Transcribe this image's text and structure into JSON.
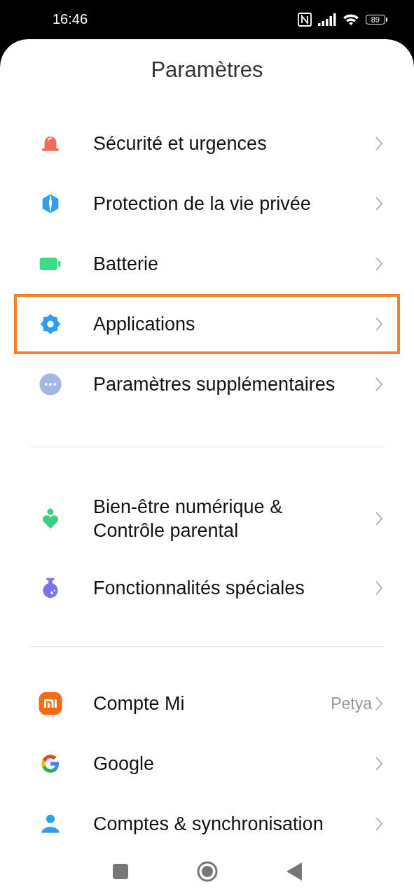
{
  "status_bar": {
    "time": "16:46",
    "battery": "89"
  },
  "title": "Paramètres",
  "groups": [
    {
      "items": [
        {
          "label": "Sécurité et urgences",
          "highlighted": false
        },
        {
          "label": "Protection de la vie privée",
          "highlighted": false
        },
        {
          "label": "Batterie",
          "highlighted": false
        },
        {
          "label": "Applications",
          "highlighted": true
        },
        {
          "label": "Paramètres supplémentaires",
          "highlighted": false
        }
      ]
    },
    {
      "items": [
        {
          "label": "Bien-être numérique & Contrôle parental",
          "highlighted": false
        },
        {
          "label": "Fonctionnalités spéciales",
          "highlighted": false
        }
      ]
    },
    {
      "items": [
        {
          "label": "Compte Mi",
          "value": "Petya",
          "highlighted": false
        },
        {
          "label": "Google",
          "highlighted": false
        },
        {
          "label": "Comptes & synchronisation",
          "highlighted": false
        }
      ]
    }
  ]
}
